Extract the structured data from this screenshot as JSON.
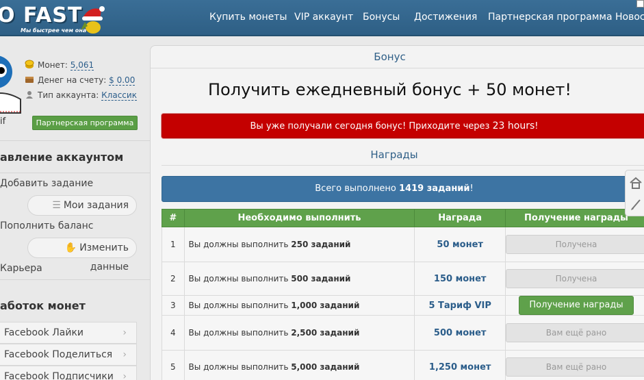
{
  "logo": {
    "wordmark": "O FAST",
    "tagline": "Мы быстрее чем она"
  },
  "nav": {
    "items": [
      "Купить монеты",
      "VIP аккаунт",
      "Бонусы",
      "Достижения",
      "Партнерская программа",
      "Новос"
    ]
  },
  "profile": {
    "nickname_fragment": "if",
    "coins_label": "Монет:",
    "coins_value": "5,061",
    "money_label": "Денег на счету:",
    "money_value": "$ 0.00",
    "type_label": "Тип аккаунта:",
    "type_value": "Классик",
    "partner_button": "Партнерская программа"
  },
  "sidebar": {
    "account_header": "авление аккаунтом",
    "items": [
      "Добавить задание",
      "Мои задания",
      "Пополнить баланс",
      "Изменить данные",
      "Карьера"
    ],
    "earn_header": "аботок монет",
    "earn_items": [
      "Facebook Лайки",
      "Facebook Поделиться",
      "Facebook Подписчики"
    ]
  },
  "panel": {
    "header": "Бонус",
    "title": "Получить ежедневный бонус + 50 монет!",
    "alert_prefix": "Вы уже получали сегодня бонус! Приходите через",
    "alert_time": "23 hours",
    "alert_suffix": "!",
    "rewards_header": "Награды",
    "info_prefix": "Всего выполнено",
    "info_count": "1419 заданий",
    "info_suffix": "!"
  },
  "table": {
    "headers": [
      "#",
      "Необходимо выполнить",
      "Награда",
      "Получение награды"
    ],
    "req_prefix": "Вы должны выполнить",
    "rows": [
      {
        "n": "1",
        "req": "250 заданий",
        "reward": "50 монет",
        "action": "Получена"
      },
      {
        "n": "2",
        "req": "500 заданий",
        "reward": "150 монет",
        "action": "Получена"
      },
      {
        "n": "3",
        "req": "1,000 заданий",
        "reward": "5 Тариф VIP",
        "action": "Получение награды"
      },
      {
        "n": "4",
        "req": "2,500 заданий",
        "reward": "500 монет",
        "action": "Вам ещё рано"
      },
      {
        "n": "5",
        "req": "5,000 заданий",
        "reward": "1,250 монет",
        "action": "Вам ещё рано"
      }
    ]
  },
  "colors": {
    "header_blue": "#2e5f85",
    "alert_red": "#c40000",
    "info_blue": "#3d74a3",
    "green": "#5fa14b",
    "link_blue": "#2b5d8a"
  },
  "icons": [
    "santa-hat-icon",
    "coin-icon",
    "wallet-icon",
    "user-type-icon",
    "list-icon",
    "hand-icon",
    "chevron-right-icon",
    "home-icon",
    "pencil-icon"
  ]
}
